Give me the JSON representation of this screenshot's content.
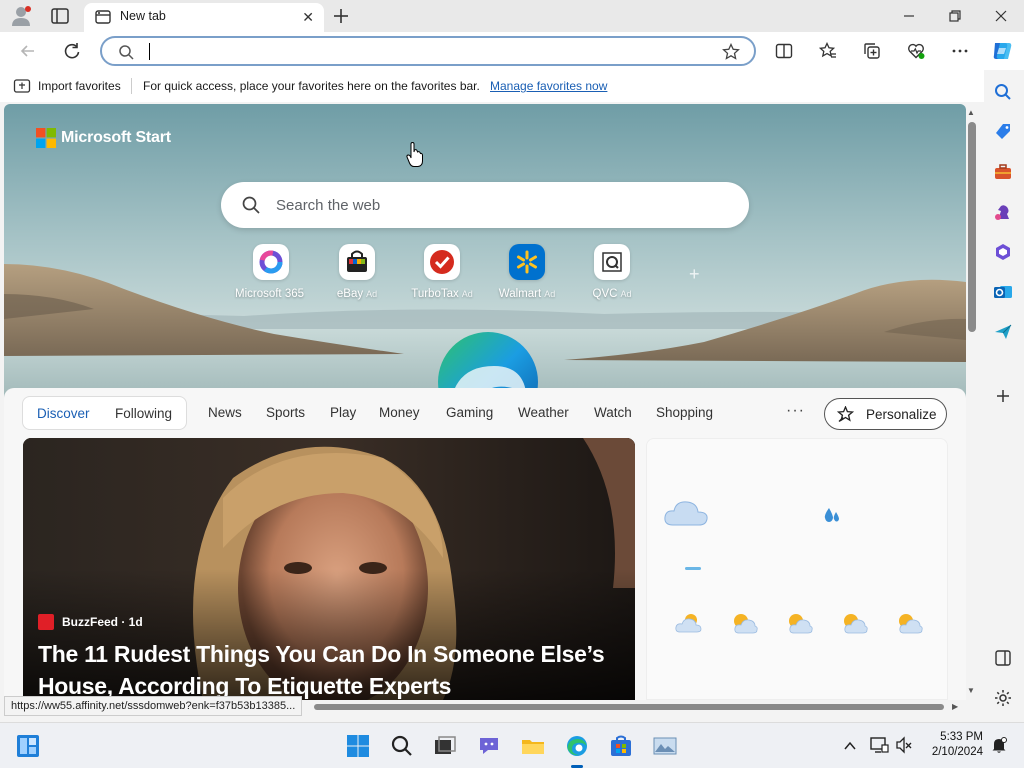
{
  "browser": {
    "tab": {
      "title": "New tab"
    },
    "omnibox": {
      "value": "",
      "placeholder": ""
    },
    "favorites_bar": {
      "import_label": "Import favorites",
      "hint": "For quick access, place your favorites here on the favorites bar.",
      "manage_link": "Manage favorites now"
    },
    "status_url": "https://ww55.affinity.net/sssdomweb?enk=f37b53b13385..."
  },
  "page": {
    "brand": "Microsoft Start",
    "search": {
      "placeholder": "Search the web"
    },
    "quick_links": [
      {
        "label": "Microsoft 365",
        "ad": "",
        "icon": "microsoft-365-icon"
      },
      {
        "label": "eBay",
        "ad": "Ad",
        "icon": "ebay-icon"
      },
      {
        "label": "TurboTax",
        "ad": "Ad",
        "icon": "turbotax-icon"
      },
      {
        "label": "Walmart",
        "ad": "Ad",
        "icon": "walmart-icon"
      },
      {
        "label": "QVC",
        "ad": "Ad",
        "icon": "qvc-icon"
      }
    ],
    "feed_tabs": {
      "discover": "Discover",
      "following": "Following"
    },
    "categories": [
      "News",
      "Sports",
      "Play",
      "Money",
      "Gaming",
      "Weather",
      "Watch",
      "Shopping"
    ],
    "more_label": "···",
    "personalize_label": "Personalize",
    "hero_story": {
      "source": "BuzzFeed · 1d",
      "headline": "The 11 Rudest Things You Can Do In Someone Else’s House, According To Etiquette Experts"
    }
  },
  "taskbar": {
    "time": "5:33 PM",
    "date": "2/10/2024"
  },
  "colors": {
    "accent": "#1a5fb4",
    "omnibox_border": "#7a9fc9",
    "windows_blue": "#005fb8"
  }
}
